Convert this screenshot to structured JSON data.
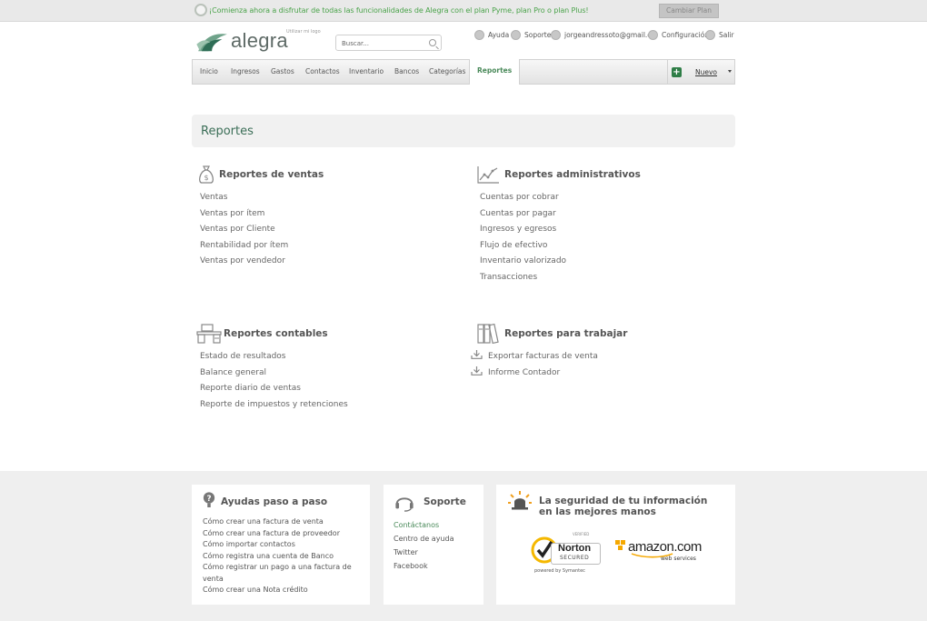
{
  "promo": {
    "text": "¡Comienza ahora a disfrutar de todas las funcionalidades de Alegra con el plan Pyme, plan Pro o plan Plus!",
    "button": "Cambiar Plan"
  },
  "brand": {
    "name": "alegra",
    "logo_hint": "Utilizar mi logo"
  },
  "search": {
    "placeholder": "Buscar..."
  },
  "toplinks": [
    {
      "label": "Ayuda",
      "icon": "help-icon"
    },
    {
      "label": "Soporte",
      "icon": "support-icon"
    },
    {
      "label": "jorgeandressoto@gmail.c...",
      "icon": "user-icon"
    },
    {
      "label": "Configuración",
      "icon": "gear-icon"
    },
    {
      "label": "Salir",
      "icon": "logout-icon"
    }
  ],
  "nav": {
    "items": [
      "Inicio",
      "Ingresos",
      "Gastos",
      "Contactos",
      "Inventario",
      "Bancos",
      "Categorías",
      "Reportes"
    ],
    "active": "Reportes",
    "new_label": "Nuevo"
  },
  "page": {
    "title": "Reportes"
  },
  "sections": {
    "ventas": {
      "title": "Reportes de ventas",
      "icon": "money-bag-icon",
      "links": [
        "Ventas",
        "Ventas por ítem",
        "Ventas por Cliente",
        "Rentabilidad por ítem",
        "Ventas por vendedor"
      ]
    },
    "administrativos": {
      "title": "Reportes administrativos",
      "icon": "line-chart-icon",
      "links": [
        "Cuentas por cobrar",
        "Cuentas por pagar",
        "Ingresos y egresos",
        "Flujo de efectivo",
        "Inventario valorizado",
        "Transacciones"
      ]
    },
    "contables": {
      "title": "Reportes contables",
      "icon": "desk-icon",
      "links": [
        "Estado de resultados",
        "Balance general",
        "Reporte diario de ventas",
        "Reporte de impuestos y retenciones"
      ]
    },
    "trabajar": {
      "title": "Reportes para trabajar",
      "icon": "binders-icon",
      "links": [
        "Exportar facturas de venta",
        "Informe Contador"
      ]
    }
  },
  "footer": {
    "ayudas": {
      "title": "Ayudas paso a paso",
      "links": [
        "Cómo crear una factura de venta",
        "Cómo crear una factura de proveedor",
        "Cómo importar contactos",
        "Cómo registra una cuenta de Banco",
        "Cómo registrar un pago a una factura de venta",
        "Cómo crear una Nota crédito"
      ]
    },
    "soporte": {
      "title": "Soporte",
      "links": [
        "Contáctanos",
        "Centro de ayuda",
        "Twitter",
        "Facebook"
      ]
    },
    "seguridad": {
      "title": "La seguridad de tu información en las mejores manos",
      "norton": {
        "verified": "VERIFIED",
        "name": "Norton",
        "secured": "SECURED",
        "powered": "powered by Symantec"
      },
      "amazon": {
        "name": "amazon.com",
        "sub": "web services"
      }
    }
  },
  "colors": {
    "brand_green": "#3b6e57",
    "promo_green": "#4aa34a",
    "new_button": "#2e7d46"
  }
}
